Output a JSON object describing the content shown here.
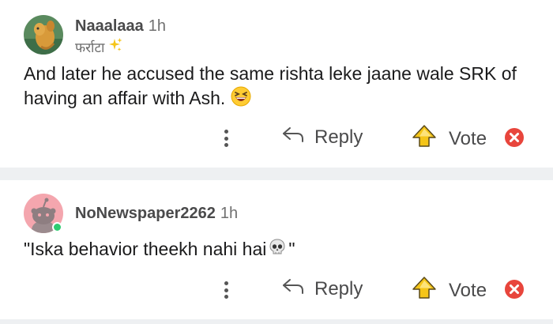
{
  "comments": [
    {
      "username": "Naaalaaa",
      "time": "1h",
      "flair": "फर्राटा",
      "flair_icon": "sparkles-icon",
      "body": "And later he accused the same rishta leke jaane wale SRK of having an affair with Ash.",
      "body_emoji": "grinning-squinting-face-icon",
      "actions": {
        "reply": "Reply",
        "vote": "Vote"
      }
    },
    {
      "username": "NoNewspaper2262",
      "time": "1h",
      "body": "\"Iska behavior theekh nahi hai",
      "body_after": "\"",
      "body_emoji": "skull-icon",
      "online": true,
      "actions": {
        "reply": "Reply",
        "vote": "Vote"
      }
    }
  ],
  "colors": {
    "background": "#ffffff",
    "separator": "#eef0f2",
    "online": "#2ecc71",
    "close": "#e8453c",
    "upvote": "#f5c518",
    "avatar2_bg": "#f4a6ae"
  }
}
